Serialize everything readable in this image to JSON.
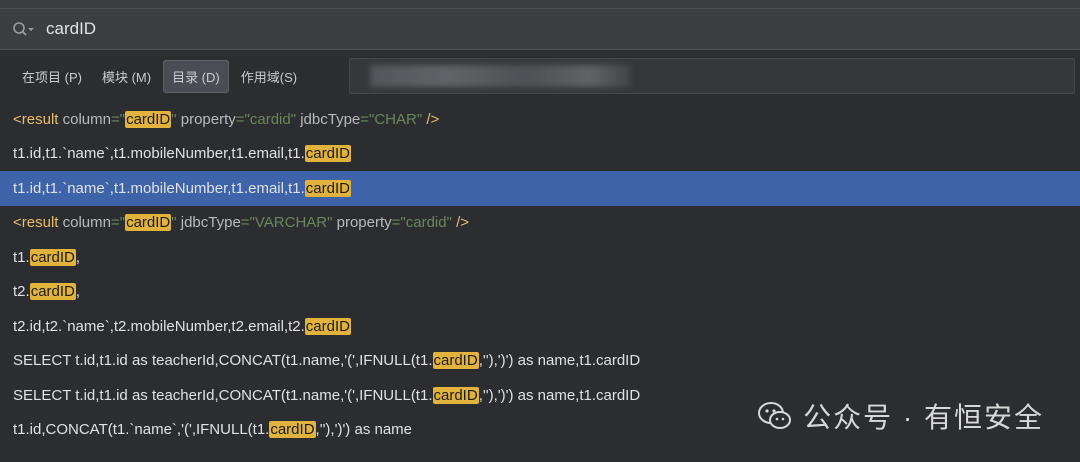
{
  "search": {
    "value": "cardID"
  },
  "scope_tabs": [
    {
      "label": "在项目 (P)",
      "active": false
    },
    {
      "label": "模块 (M)",
      "active": false
    },
    {
      "label": "目录 (D)",
      "active": true
    },
    {
      "label": "作用域(S)",
      "active": false
    }
  ],
  "scope_path": "",
  "results": [
    {
      "selected": false,
      "segments": [
        {
          "t": "<result ",
          "c": "tag"
        },
        {
          "t": "column",
          "c": "attr"
        },
        {
          "t": "=\"",
          "c": "val"
        },
        {
          "t": "cardID",
          "c": "hl"
        },
        {
          "t": "\" ",
          "c": "val"
        },
        {
          "t": "property",
          "c": "attr"
        },
        {
          "t": "=\"cardid\" ",
          "c": "val"
        },
        {
          "t": "jdbcType",
          "c": "attr"
        },
        {
          "t": "=\"CHAR\" ",
          "c": "val"
        },
        {
          "t": "/>",
          "c": "tag"
        }
      ]
    },
    {
      "selected": false,
      "segments": [
        {
          "t": "t1.id,t1.`name`,t1.mobileNumber,t1.email,t1.",
          "c": "text"
        },
        {
          "t": "cardID",
          "c": "hl"
        }
      ]
    },
    {
      "selected": true,
      "segments": [
        {
          "t": "t1.id,t1.`name`,t1.mobileNumber,t1.email,t1.",
          "c": "text"
        },
        {
          "t": "cardID",
          "c": "hl"
        }
      ]
    },
    {
      "selected": false,
      "segments": [
        {
          "t": "<result ",
          "c": "tag"
        },
        {
          "t": "column",
          "c": "attr"
        },
        {
          "t": "=\"",
          "c": "val"
        },
        {
          "t": "cardID",
          "c": "hl"
        },
        {
          "t": "\" ",
          "c": "val"
        },
        {
          "t": "jdbcType",
          "c": "attr"
        },
        {
          "t": "=\"VARCHAR\" ",
          "c": "val"
        },
        {
          "t": "property",
          "c": "attr"
        },
        {
          "t": "=\"cardid\" ",
          "c": "val"
        },
        {
          "t": "/>",
          "c": "tag"
        }
      ]
    },
    {
      "selected": false,
      "segments": [
        {
          "t": "t1.",
          "c": "text"
        },
        {
          "t": "cardID",
          "c": "hl"
        },
        {
          "t": ",",
          "c": "text"
        }
      ]
    },
    {
      "selected": false,
      "segments": [
        {
          "t": "t2.",
          "c": "text"
        },
        {
          "t": "cardID",
          "c": "hl"
        },
        {
          "t": ",",
          "c": "text"
        }
      ]
    },
    {
      "selected": false,
      "segments": [
        {
          "t": "t2.id,t2.`name`,t2.mobileNumber,t2.email,t2.",
          "c": "text"
        },
        {
          "t": "cardID",
          "c": "hl"
        }
      ]
    },
    {
      "selected": false,
      "segments": [
        {
          "t": "SELECT t.id,t1.id as teacherId,CONCAT(t1.name,'(',IFNULL(t1.",
          "c": "text"
        },
        {
          "t": "cardID",
          "c": "hl"
        },
        {
          "t": ",''),')') as name,t1.cardID",
          "c": "text"
        }
      ]
    },
    {
      "selected": false,
      "segments": [
        {
          "t": "SELECT t.id,t1.id as teacherId,CONCAT(t1.name,'(',IFNULL(t1.",
          "c": "text"
        },
        {
          "t": "cardID",
          "c": "hl"
        },
        {
          "t": ",''),')') as name,t1.cardID",
          "c": "text"
        }
      ]
    },
    {
      "selected": false,
      "segments": [
        {
          "t": "t1.id,CONCAT(t1.`name`,'(',IFNULL(t1.",
          "c": "text"
        },
        {
          "t": "cardID",
          "c": "hl"
        },
        {
          "t": ",''),')') as name",
          "c": "text"
        }
      ]
    }
  ],
  "watermark": {
    "text": "公众号 · 有恒安全",
    "icon": "wechat-icon"
  },
  "colors": {
    "background": "#2b2d30",
    "selection": "#3f63a8",
    "highlight": "#e2b33c",
    "xml_tag": "#e8bf6a",
    "xml_value": "#6a8759"
  }
}
